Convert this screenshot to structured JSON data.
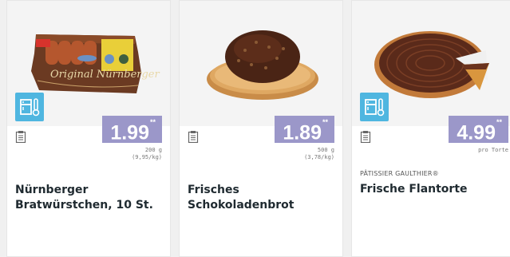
{
  "products": [
    {
      "name": "Nürnberger Bratwürstchen, 10 St.",
      "price": "1.99",
      "price_suffix": "**",
      "unit_size": "200 g",
      "unit_price": "(9,95/kg)",
      "brand": "",
      "package_text": "Original Nürnberger",
      "icon": "fridge-icon"
    },
    {
      "name": "Frisches Schokoladenbrot",
      "price": "1.89",
      "price_suffix": "**",
      "unit_size": "500 g",
      "unit_price": "(3,78/kg)",
      "brand": "",
      "icon": ""
    },
    {
      "name": "Frische Flantorte",
      "price": "4.99",
      "price_suffix": "**",
      "unit_size": "pro Torte",
      "unit_price": "",
      "brand": "PÂTISSIER GAULTHIER®",
      "icon": "fridge-icon"
    }
  ],
  "colors": {
    "price_bg": "#9b97c9",
    "fridge_bg": "#4fb6e0",
    "image_bg": "#f4f4f4"
  }
}
